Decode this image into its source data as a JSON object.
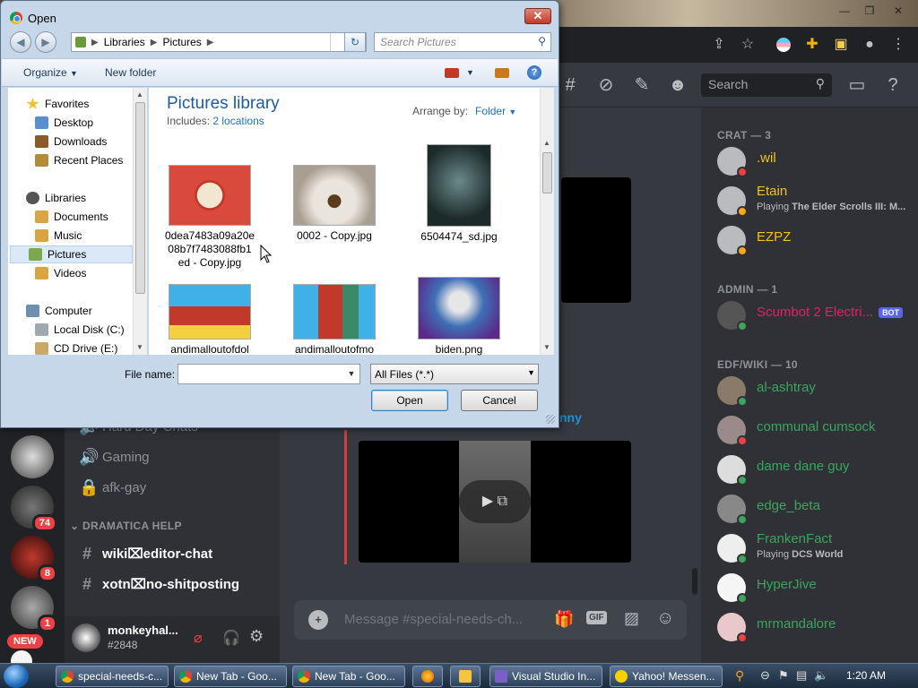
{
  "dialog": {
    "title": "Open",
    "address": [
      "Libraries",
      "Pictures"
    ],
    "search_placeholder": "Search Pictures",
    "toolbar": {
      "organize": "Organize",
      "new_folder": "New folder"
    },
    "nav": {
      "favorites": "Favorites",
      "desktop": "Desktop",
      "downloads": "Downloads",
      "recent": "Recent Places",
      "libraries": "Libraries",
      "documents": "Documents",
      "music": "Music",
      "pictures": "Pictures",
      "videos": "Videos",
      "computer": "Computer",
      "local_disk": "Local Disk (C:)",
      "cd_drive": "CD Drive (E:)"
    },
    "library": {
      "title": "Pictures library",
      "includes_label": "Includes:",
      "includes_link": "2 locations",
      "arrange_label": "Arrange by:",
      "arrange_value": "Folder"
    },
    "files": [
      {
        "line1": "0dea7483a09a20e",
        "line2": "08b7f7483088fb1",
        "line3": "ed - Copy.jpg"
      },
      {
        "line1": "0002 - Copy.jpg"
      },
      {
        "line1": "6504474_sd.jpg"
      },
      {
        "line1": "andimalloutofdol"
      },
      {
        "line1": "andimalloutofmo"
      },
      {
        "line1": "biden.png"
      }
    ],
    "filename_label": "File name:",
    "filename_value": "",
    "filter": "All Files (*.*)",
    "open_button": "Open",
    "cancel_button": "Cancel"
  },
  "discord": {
    "search": "Search",
    "channels": {
      "partial": "Hard Day Chats",
      "gaming": "Gaming",
      "afk": "afk-gay",
      "category": "DRAMATICA HELP",
      "wiki": "wiki⌧editor-chat",
      "xotn": "xotn⌧no-shitposting"
    },
    "user": {
      "name": "monkeyhal...",
      "tag": "#2848"
    },
    "guild_badges": [
      "74",
      "8",
      "1"
    ],
    "new_badge": "NEW",
    "message_placeholder": "Message #special-needs-ch...",
    "gif": "GIF",
    "partial_name": "nny",
    "member_groups": [
      {
        "header": "CRAT — 3"
      },
      {
        "header": "ADMIN — 1"
      },
      {
        "header": "EDF/WIKI — 10"
      }
    ],
    "members": [
      {
        "name": ".wil",
        "color": "#f0c419",
        "status": "#ed4245"
      },
      {
        "name": "Etain",
        "color": "#f0c419",
        "status": "#faa61a",
        "activity_prefix": "Playing ",
        "activity": "The Elder Scrolls III: M..."
      },
      {
        "name": "EZPZ",
        "color": "#f0c419",
        "status": "#faa61a"
      },
      {
        "name": "Scumbot 2 Electri...",
        "color": "#e91e63",
        "status": "#3ba55d",
        "bot": "BOT"
      },
      {
        "name": "al-ashtray",
        "color": "#3ba55d",
        "status": "#3ba55d"
      },
      {
        "name": "communal cumsock",
        "color": "#3ba55d",
        "status": "#ed4245"
      },
      {
        "name": "dame dane guy",
        "color": "#3ba55d",
        "status": "#3ba55d"
      },
      {
        "name": "edge_beta",
        "color": "#3ba55d",
        "status": "#3ba55d"
      },
      {
        "name": "FrankenFact",
        "color": "#3ba55d",
        "status": "#3ba55d",
        "activity_prefix": "Playing ",
        "activity": "DCS World"
      },
      {
        "name": "HyperJive",
        "color": "#3ba55d",
        "status": "#3ba55d"
      },
      {
        "name": "mrmandalore",
        "color": "#3ba55d",
        "status": "#ed4245"
      }
    ]
  },
  "taskbar": {
    "items": [
      "special-needs-c...",
      "New Tab - Goo...",
      "New Tab - Goo...",
      "Visual Studio In...",
      "Yahoo! Messen..."
    ],
    "clock": "1:20 AM"
  }
}
